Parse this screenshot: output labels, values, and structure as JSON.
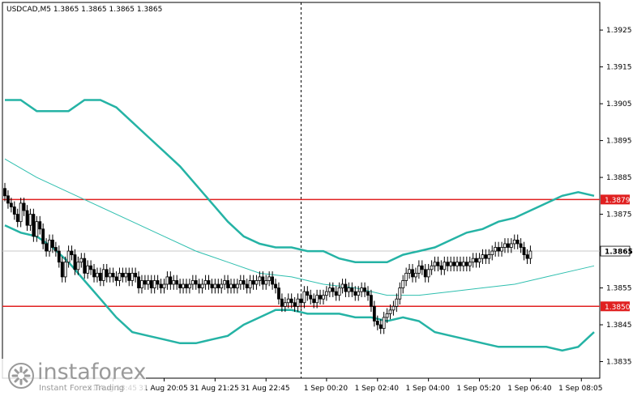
{
  "chart_data": {
    "type": "candlestick",
    "title": "USDCAD,M5  1.3865 1.3865 1.3865 1.3865",
    "symbol": "USDCAD",
    "timeframe": "M5",
    "ohlc_readout": "1.3865 1.3865 1.3865 1.3865",
    "ylim": [
      1.38305,
      1.39325
    ],
    "y_ticks": [
      "1.3925",
      "1.3915",
      "1.3905",
      "1.3895",
      "1.3885",
      "1.3875",
      "1.3865",
      "1.3855",
      "1.3845",
      "1.3835"
    ],
    "x_ticks": [
      "31 Aug 18:45",
      "31 Aug 20:05",
      "31 Aug 21:25",
      "31 Aug 22:45",
      "1 Sep 00:20",
      "1 Sep 02:40",
      "1 Sep 04:00",
      "1 Sep 05:20",
      "1 Sep 06:40",
      "1 Sep 08:05"
    ],
    "x_ticks_index": [
      34,
      50,
      66,
      82,
      101,
      117,
      133,
      149,
      165,
      181
    ],
    "grid": false,
    "levels": [
      {
        "label": "1.3879",
        "value": 1.3879,
        "color": "#e02020"
      },
      {
        "label": "1.3850",
        "value": 1.385,
        "color": "#e02020"
      }
    ],
    "current_price": {
      "label": "1.3865",
      "value": 1.3865
    },
    "vline_index": 93,
    "x_count": 186,
    "series": [
      {
        "kind": "bollinger_upper",
        "color": "#25b3a5",
        "points": [
          [
            0,
            1.3906
          ],
          [
            5,
            1.3906
          ],
          [
            10,
            1.3903
          ],
          [
            15,
            1.3903
          ],
          [
            20,
            1.3903
          ],
          [
            25,
            1.3906
          ],
          [
            30,
            1.3906
          ],
          [
            35,
            1.3904
          ],
          [
            40,
            1.39
          ],
          [
            45,
            1.3896
          ],
          [
            50,
            1.3892
          ],
          [
            55,
            1.3888
          ],
          [
            60,
            1.3883
          ],
          [
            65,
            1.3878
          ],
          [
            70,
            1.3873
          ],
          [
            75,
            1.3869
          ],
          [
            80,
            1.3867
          ],
          [
            85,
            1.3866
          ],
          [
            90,
            1.3866
          ],
          [
            95,
            1.3865
          ],
          [
            100,
            1.3865
          ],
          [
            105,
            1.3863
          ],
          [
            110,
            1.3862
          ],
          [
            115,
            1.3862
          ],
          [
            120,
            1.3862
          ],
          [
            125,
            1.3864
          ],
          [
            130,
            1.3865
          ],
          [
            135,
            1.3866
          ],
          [
            140,
            1.3868
          ],
          [
            145,
            1.387
          ],
          [
            150,
            1.3871
          ],
          [
            155,
            1.3873
          ],
          [
            160,
            1.3874
          ],
          [
            165,
            1.3876
          ],
          [
            170,
            1.3878
          ],
          [
            175,
            1.388
          ],
          [
            180,
            1.3881
          ],
          [
            185,
            1.388
          ]
        ]
      },
      {
        "kind": "moving_average",
        "color": "#2fbfaf",
        "points": [
          [
            0,
            1.389
          ],
          [
            10,
            1.3885
          ],
          [
            20,
            1.3881
          ],
          [
            30,
            1.3877
          ],
          [
            40,
            1.3873
          ],
          [
            50,
            1.3869
          ],
          [
            60,
            1.3865
          ],
          [
            70,
            1.3862
          ],
          [
            80,
            1.3859
          ],
          [
            90,
            1.3858
          ],
          [
            100,
            1.3856
          ],
          [
            110,
            1.3855
          ],
          [
            120,
            1.3853
          ],
          [
            130,
            1.3853
          ],
          [
            140,
            1.3854
          ],
          [
            150,
            1.3855
          ],
          [
            160,
            1.3856
          ],
          [
            170,
            1.3858
          ],
          [
            180,
            1.386
          ],
          [
            185,
            1.3861
          ]
        ]
      },
      {
        "kind": "bollinger_lower",
        "color": "#25b3a5",
        "points": [
          [
            0,
            1.3872
          ],
          [
            5,
            1.387
          ],
          [
            10,
            1.3869
          ],
          [
            15,
            1.3866
          ],
          [
            20,
            1.3862
          ],
          [
            25,
            1.3857
          ],
          [
            30,
            1.3852
          ],
          [
            35,
            1.3847
          ],
          [
            40,
            1.3843
          ],
          [
            45,
            1.3842
          ],
          [
            50,
            1.3841
          ],
          [
            55,
            1.384
          ],
          [
            60,
            1.384
          ],
          [
            65,
            1.3841
          ],
          [
            70,
            1.3842
          ],
          [
            75,
            1.3845
          ],
          [
            80,
            1.3847
          ],
          [
            85,
            1.3849
          ],
          [
            90,
            1.3849
          ],
          [
            95,
            1.3848
          ],
          [
            100,
            1.3848
          ],
          [
            105,
            1.3848
          ],
          [
            110,
            1.3847
          ],
          [
            115,
            1.3847
          ],
          [
            120,
            1.3846
          ],
          [
            125,
            1.3847
          ],
          [
            130,
            1.3846
          ],
          [
            135,
            1.3843
          ],
          [
            140,
            1.3842
          ],
          [
            145,
            1.3841
          ],
          [
            150,
            1.384
          ],
          [
            155,
            1.3839
          ],
          [
            160,
            1.3839
          ],
          [
            165,
            1.3839
          ],
          [
            170,
            1.3839
          ],
          [
            175,
            1.3838
          ],
          [
            180,
            1.3839
          ],
          [
            185,
            1.3843
          ]
        ]
      }
    ],
    "candles_close": [
      1.388,
      1.3878,
      1.3877,
      1.3875,
      1.3873,
      1.3878,
      1.3876,
      1.3872,
      1.3875,
      1.3869,
      1.3873,
      1.3871,
      1.3867,
      1.3865,
      1.3868,
      1.3866,
      1.3865,
      1.3862,
      1.3858,
      1.3862,
      1.3865,
      1.3864,
      1.386,
      1.3862,
      1.3863,
      1.3859,
      1.3861,
      1.386,
      1.3858,
      1.3859,
      1.3857,
      1.386,
      1.3858,
      1.3859,
      1.3858,
      1.3857,
      1.3859,
      1.3858,
      1.3859,
      1.3857,
      1.3859,
      1.3858,
      1.3855,
      1.3857,
      1.3856,
      1.3857,
      1.3855,
      1.3857,
      1.3856,
      1.3855,
      1.3856,
      1.3858,
      1.3856,
      1.3857,
      1.3856,
      1.3855,
      1.3856,
      1.3855,
      1.3856,
      1.3857,
      1.3856,
      1.3855,
      1.3856,
      1.3857,
      1.3856,
      1.3855,
      1.3856,
      1.3855,
      1.3856,
      1.3857,
      1.3855,
      1.3856,
      1.3855,
      1.3856,
      1.3857,
      1.3856,
      1.3855,
      1.3857,
      1.3856,
      1.3857,
      1.3858,
      1.3856,
      1.3857,
      1.3858,
      1.3856,
      1.3855,
      1.3852,
      1.385,
      1.3851,
      1.3852,
      1.3851,
      1.385,
      1.3852,
      1.3851,
      1.3854,
      1.3853,
      1.3852,
      1.3851,
      1.3853,
      1.3852,
      1.3853,
      1.3854,
      1.3855,
      1.3854,
      1.3853,
      1.3855,
      1.3856,
      1.3854,
      1.3855,
      1.3854,
      1.3853,
      1.3854,
      1.3855,
      1.3854,
      1.3853,
      1.385,
      1.3846,
      1.3845,
      1.3844,
      1.3847,
      1.3848,
      1.3849,
      1.385,
      1.3852,
      1.3855,
      1.3857,
      1.3859,
      1.386,
      1.3858,
      1.3859,
      1.3861,
      1.386,
      1.3858,
      1.386,
      1.3861,
      1.3862,
      1.3861,
      1.386,
      1.3862,
      1.3861,
      1.3862,
      1.3861,
      1.3862,
      1.3861,
      1.3862,
      1.3861,
      1.3862,
      1.3863,
      1.3862,
      1.3863,
      1.3864,
      1.3863,
      1.3864,
      1.3865,
      1.3866,
      1.3865,
      1.3866,
      1.3867,
      1.3866,
      1.3867,
      1.3868,
      1.3867,
      1.3866,
      1.3864,
      1.3863,
      1.3865
    ]
  },
  "watermark": {
    "brand": "instaforex",
    "tagline": "Instant Forex Trading"
  }
}
